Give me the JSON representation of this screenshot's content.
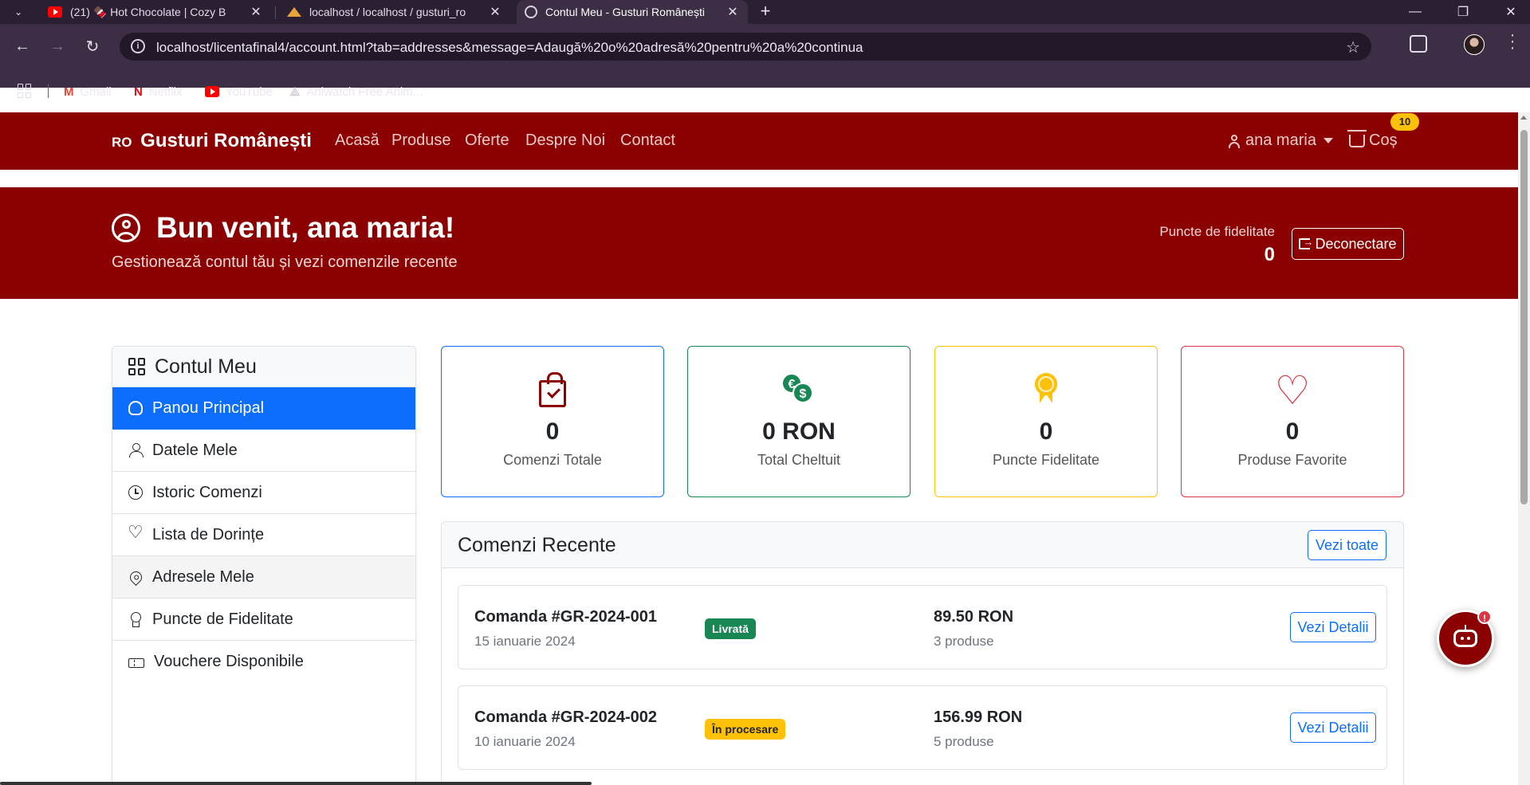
{
  "browser": {
    "tabs": [
      {
        "title": "(21) 🍫 Hot Chocolate | Cozy B",
        "favicon": "youtube-icon",
        "active": false
      },
      {
        "title": "localhost / localhost / gusturi_ro",
        "favicon": "phpmyadmin-icon",
        "active": false
      },
      {
        "title": "Contul Meu - Gusturi Românești",
        "favicon": "globe-icon",
        "active": true
      }
    ],
    "url": "localhost/licentafinal4/account.html?tab=addresses&message=Adaugă%20o%20adresă%20pentru%20a%20continua",
    "bookmarks": [
      {
        "label": "Gmail",
        "icon": "gmail-icon"
      },
      {
        "label": "Netflix",
        "icon": "netflix-icon"
      },
      {
        "label": "YouTube",
        "icon": "youtube-icon"
      },
      {
        "label": "Aniwatch Free Anim...",
        "icon": "aniwatch-icon"
      }
    ]
  },
  "site": {
    "brand_prefix": "RO",
    "brand": "Gusturi Românești",
    "nav": [
      "Acasă",
      "Produse",
      "Oferte",
      "Despre Noi",
      "Contact"
    ],
    "user": "ana maria",
    "cart_label": "Coș",
    "cart_count": "10",
    "accent_color": "#8b0000"
  },
  "hero": {
    "title": "Bun venit, ana maria!",
    "subtitle": "Gestionează contul tău și vezi comenzile recente",
    "fidelity_label": "Puncte de fidelitate",
    "fidelity_value": "0",
    "logout": "Deconectare"
  },
  "sidebar": {
    "title": "Contul Meu",
    "items": [
      {
        "label": "Panou Principal",
        "icon": "speedometer-icon",
        "state": "active"
      },
      {
        "label": "Datele Mele",
        "icon": "person-icon",
        "state": ""
      },
      {
        "label": "Istoric Comenzi",
        "icon": "clock-history-icon",
        "state": ""
      },
      {
        "label": "Lista de Dorințe",
        "icon": "heart-icon",
        "state": ""
      },
      {
        "label": "Adresele Mele",
        "icon": "geo-pin-icon",
        "state": "hover"
      },
      {
        "label": "Puncte de Fidelitate",
        "icon": "award-icon",
        "state": ""
      },
      {
        "label": "Vouchere Disponibile",
        "icon": "ticket-icon",
        "state": ""
      }
    ]
  },
  "stats": [
    {
      "value": "0",
      "label": "Comenzi Totale",
      "icon": "bag-check-icon",
      "border": "#0d6efd"
    },
    {
      "value": "0 RON",
      "label": "Total Cheltuit",
      "icon": "currency-exchange-icon",
      "border": "#198754"
    },
    {
      "value": "0",
      "label": "Puncte Fidelitate",
      "icon": "award-medal-icon",
      "border": "#ffc107"
    },
    {
      "value": "0",
      "label": "Produse Favorite",
      "icon": "heart-icon",
      "border": "#dc3545"
    }
  ],
  "orders": {
    "title": "Comenzi Recente",
    "view_all": "Vezi toate",
    "details_label": "Vezi Detalii",
    "items": [
      {
        "id": "Comanda #GR-2024-001",
        "date": "15 ianuarie 2024",
        "status": "Livrată",
        "status_color": "#198754",
        "total": "89.50 RON",
        "count": "3 produse"
      },
      {
        "id": "Comanda #GR-2024-002",
        "date": "10 ianuarie 2024",
        "status": "În procesare",
        "status_color": "#ffc107",
        "total": "156.99 RON",
        "count": "5 produse"
      }
    ]
  },
  "chat": {
    "alert": "!"
  }
}
